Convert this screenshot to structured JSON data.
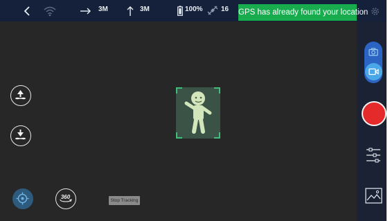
{
  "status_bar": {
    "distance_horizontal": "3M",
    "distance_vertical": "3M",
    "battery": "100%",
    "satellites": "16",
    "gps_message": "GPS has already found your location"
  },
  "controls": {
    "stop_tracking_label": "Stop Tracking",
    "orbit_label": "360"
  },
  "mode_toggle": {
    "options": [
      "photo",
      "video"
    ],
    "selected": "video"
  },
  "icons": [
    "back-arrow-icon",
    "wifi-signal-icon",
    "horizontal-distance-icon",
    "vertical-distance-icon",
    "battery-icon",
    "satellite-icon",
    "settings-gear-icon",
    "takeoff-icon",
    "landing-icon",
    "target-lock-icon",
    "orbit-360-icon",
    "camera-icon",
    "video-icon",
    "adjust-sliders-icon",
    "gallery-icon"
  ],
  "colors": {
    "top_bar": "#15213a",
    "gps_banner": "#18ac4f",
    "background": "#272727",
    "right_panel": "#1a2234",
    "record": "#e42a2a",
    "toggle": "#2c64c4",
    "tracking_frame": "#3ec07a"
  }
}
